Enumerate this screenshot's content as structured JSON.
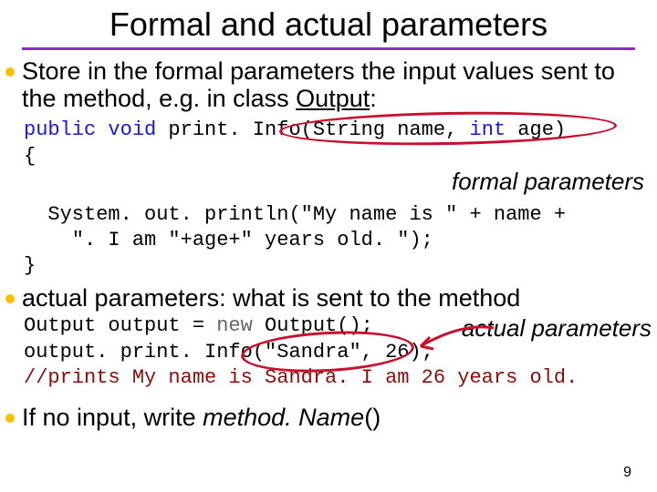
{
  "title": "Formal and actual parameters",
  "bullets": {
    "b1a": "Store in the formal parameters the input values sent to the method, e.g. in class ",
    "b1b": "Output",
    "b1c": ":",
    "b2": "actual parameters: what is sent to the method",
    "b3a": "If no input, write ",
    "b3b": "method. Name",
    "b3c": "()"
  },
  "code1": {
    "l1a": "public",
    "l1b": " ",
    "l1c": "void",
    "l1d": " print. Info(String name, ",
    "l1e": "int",
    "l1f": " age)",
    "l2": "{",
    "l3": "  System. out. println(\"My name is \" + name +",
    "l4": "    \". I am \"+age+\" years old. \");",
    "l5": "}"
  },
  "annot": {
    "formal": "formal parameters",
    "actual": "actual parameters"
  },
  "code2": {
    "l1a": "Output output = ",
    "l1b": "new",
    "l1c": " Output();",
    "l2": "output. print. Info(\"Sandra\", 26);",
    "l3": "//prints My name is Sandra. I am 26 years old."
  },
  "pageNum": "9"
}
